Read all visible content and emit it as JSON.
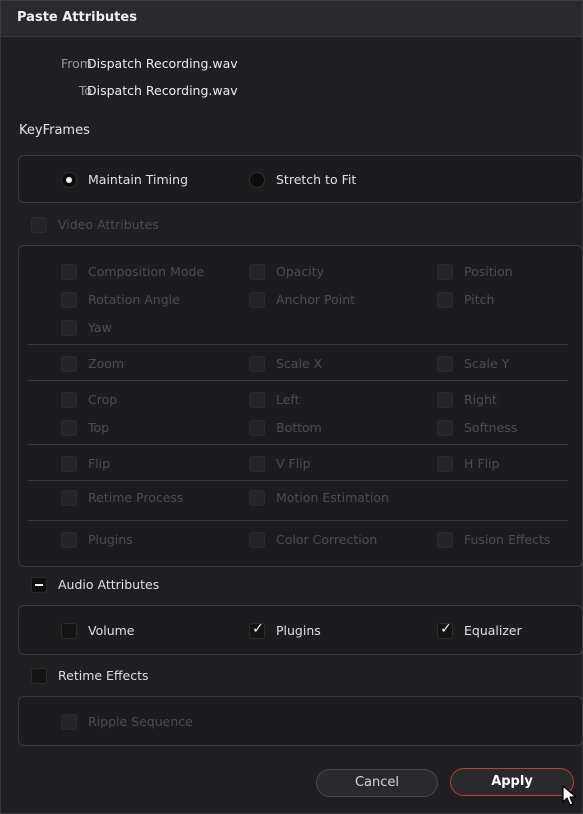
{
  "dialog": {
    "title": "Paste Attributes"
  },
  "source": {
    "from_label": "From",
    "from_value": "Dispatch Recording.wav",
    "to_label": "To",
    "to_value": "Dispatch Recording.wav"
  },
  "keyframes": {
    "header": "KeyFrames",
    "options": [
      {
        "label": "Maintain Timing",
        "selected": true
      },
      {
        "label": "Stretch to Fit",
        "selected": false
      }
    ]
  },
  "video_attributes": {
    "header": "Video Attributes",
    "groups": [
      [
        "Composition Mode",
        "Opacity",
        "Position",
        "Rotation Angle",
        "Anchor Point",
        "Pitch",
        "Yaw"
      ],
      [
        "Zoom",
        "Scale X",
        "Scale Y"
      ],
      [
        "Crop",
        "Left",
        "Right",
        "Top",
        "Bottom",
        "Softness"
      ],
      [
        "Flip",
        "V Flip",
        "H Flip"
      ],
      [
        "Retime Process",
        "Motion Estimation"
      ],
      [
        "Plugins",
        "Color Correction",
        "Fusion Effects"
      ]
    ]
  },
  "audio_attributes": {
    "header": "Audio Attributes",
    "items": [
      {
        "label": "Volume",
        "checked": false
      },
      {
        "label": "Plugins",
        "checked": true
      },
      {
        "label": "Equalizer",
        "checked": true
      }
    ]
  },
  "retime_effects": {
    "header": "Retime Effects",
    "items": [
      {
        "label": "Ripple Sequence"
      }
    ]
  },
  "buttons": {
    "cancel": "Cancel",
    "apply": "Apply"
  },
  "icons": {
    "cursor": "pointer-cursor-icon",
    "check": "checkmark-icon",
    "indeterminate": "minus-icon"
  },
  "colors": {
    "accent": "#c23a3a",
    "panel_border": "#3a3a3c",
    "background": "#1f1f21"
  }
}
